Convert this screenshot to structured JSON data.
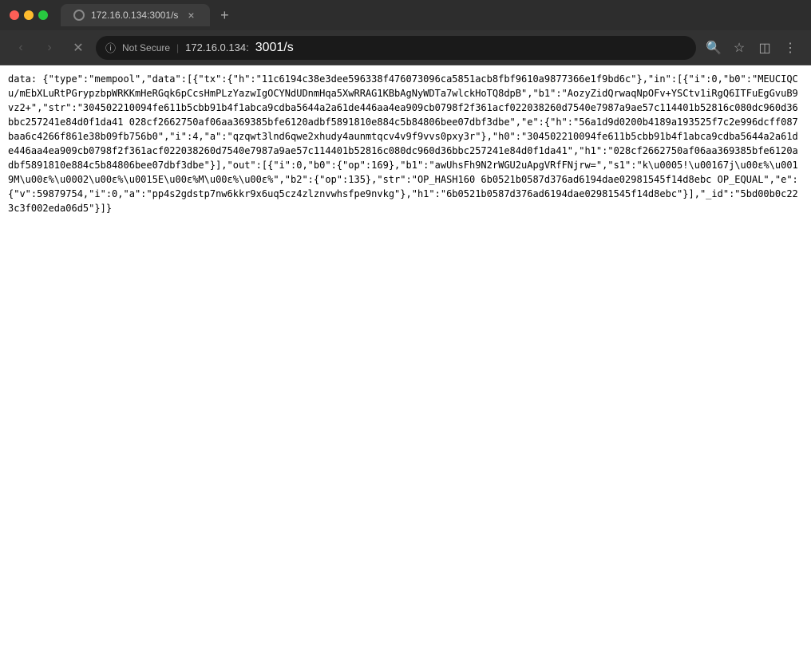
{
  "browser": {
    "tab": {
      "title": "172.16.0.134:3001/s",
      "close_label": "×"
    },
    "new_tab_label": "+",
    "nav": {
      "back_label": "‹",
      "forward_label": "›",
      "reload_label": "✕"
    },
    "address": {
      "security_icon": "ℹ",
      "not_secure": "Not Secure",
      "separator": "|",
      "url_plain": "172.16.0.134:",
      "url_highlight": "3001/s"
    },
    "toolbar": {
      "search_icon": "⌕",
      "star_icon": "☆",
      "extensions_icon": "⊞",
      "menu_icon": "⋮"
    }
  },
  "content": {
    "text": "data: {\"type\":\"mempool\",\"data\":[{\"tx\":{\"h\":\"11c6194c38e3dee596338f476073096ca5851acb8fbf9610a9877366e1f9bd6c\"},\"in\":[{\"i\":0,\"b0\":\"MEUCIQCu/mEbXLuRtPGrypzbpWRKKmHeRGqk6pCcsHmPLzYazwIgOCYNdUDnmHqa5XwRRAG1KBbAgNyWDTa7wlckHoTQ8dpB\",\"b1\":\"AozyZidQrwaqNpOFv+YSCtv1iRgQ6ITFuEgGvuB9vz2+\",\"str\":\"304502210094fe611b5cbb91b4f1abca9cdba5644a2a61de446aa4ea909cb0798f2f361acf022038260d7540e7987a9ae57c114401b52816c080dc960d36bbc257241e84d0f1da41 028cf2662750af06aa369385bfe6120adbf5891810e884c5b84806bee07dbf3dbe\",\"e\":{\"h\":\"56a1d9d0200b4189a193525f7c2e996dcff087baa6c4266f861e38b09fb756b0\",\"i\":4,\"a\":\"qzqwt3lnd6qwe2xhudy4aunmtqcv4v9f9vvs0pxy3r\"},\"h0\":\"304502210094fe611b5cbb91b4f1abca9cdba5644a2a61de446aa4ea909cb0798f2f361acf022038260d7540e7987a9ae57c114401b52816c080dc960d36bbc257241e84d0f1da41\",\"h1\":\"028cf2662750af06aa369385bfe6120adbf5891810e884c5b84806bee07dbf3dbe\"}],\"out\":[{\"i\":0,\"b0\":{\"op\":169},\"b1\":\"awUhsFh9N2rWGU2uApgVRfFNjrw=\",\"s1\":\"k\\u0005!\\u00167j\\u00ɛ%\\u0019M\\u00ɛ%\\u0002\\u00ɛ%\\u0015E\\u00ɛ%M\\u00ɛ%\\u00ɛ%\",\"b2\":{\"op\":135},\"str\":\"OP_HASH160 6b0521b0587d376ad6194dae02981545f14d8ebc OP_EQUAL\",\"e\":{\"v\":59879754,\"i\":0,\"a\":\"pp4s2gdstp7nw6kkr9x6uq5cz4zlznvwhsfpe9nvkg\"},\"h1\":\"6b0521b0587d376ad6194dae02981545f14d8ebc\"}],\"_id\":\"5bd00b0c223c3f002eda06d5\"}]}"
  }
}
